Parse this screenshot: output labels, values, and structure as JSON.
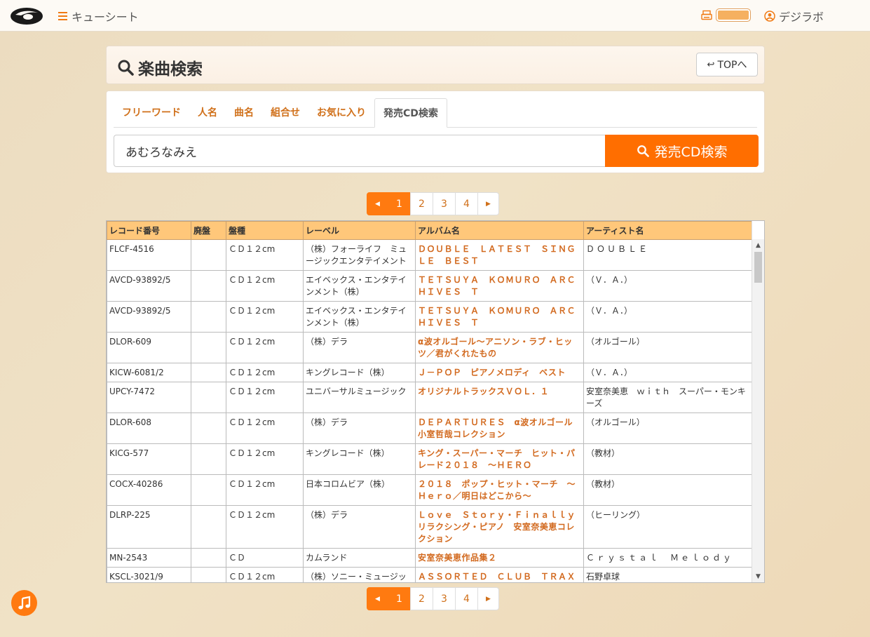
{
  "header": {
    "menu_label": "キューシート",
    "user_label": "デジラボ"
  },
  "title_panel": {
    "title": "楽曲検索",
    "top_button": "TOPへ"
  },
  "search": {
    "tabs": [
      {
        "label": "フリーワード",
        "active": false
      },
      {
        "label": "人名",
        "active": false
      },
      {
        "label": "曲名",
        "active": false
      },
      {
        "label": "組合せ",
        "active": false
      },
      {
        "label": "お気に入り",
        "active": false
      },
      {
        "label": "発売CD検索",
        "active": true
      }
    ],
    "query": "あむろなみえ",
    "button_label": "発売CD検索"
  },
  "pagination": {
    "pages": [
      "1",
      "2",
      "3",
      "4"
    ],
    "current": "1"
  },
  "table": {
    "columns": [
      "レコード番号",
      "廃盤",
      "盤種",
      "レーベル",
      "アルバム名",
      "アーティスト名"
    ],
    "rows": [
      {
        "record": "FLCF-4516",
        "discontinued": "",
        "type": "ＣＤ１２cm",
        "label": "（株）フォーライフ　ミュージックエンタテイメント",
        "album": "ＤＯＵＢＬＥ　ＬＡＴＥＳＴ　ＳＩＮＧＬＥ　ＢＥＳＴ",
        "artist": "ＤＯＵＢＬＥ"
      },
      {
        "record": "AVCD-93892/5",
        "discontinued": "",
        "type": "ＣＤ１２cm",
        "label": "エイベックス・エンタテインメント（株）",
        "album": "ＴＥＴＳＵＹＡ　ＫＯＭＵＲＯ　ＡＲＣＨＩＶＥＳ　Ｔ",
        "artist": "（Ｖ．Ａ．）"
      },
      {
        "record": "AVCD-93892/5",
        "discontinued": "",
        "type": "ＣＤ１２cm",
        "label": "エイベックス・エンタテインメント（株）",
        "album": "ＴＥＴＳＵＹＡ　ＫＯＭＵＲＯ　ＡＲＣＨＩＶＥＳ　Ｔ",
        "artist": "（Ｖ．Ａ．）"
      },
      {
        "record": "DLOR-609",
        "discontinued": "",
        "type": "ＣＤ１２cm",
        "label": "（株）デラ",
        "album": "α波オルゴール〜アニソン・ラブ・ヒッツ／君がくれたもの",
        "artist": "（オルゴール）"
      },
      {
        "record": "KICW-6081/2",
        "discontinued": "",
        "type": "ＣＤ１２cm",
        "label": "キングレコード（株）",
        "album": "Ｊ－ＰＯＰ　ピアノメロディ　ベスト",
        "artist": "（Ｖ．Ａ．）"
      },
      {
        "record": "UPCY-7472",
        "discontinued": "",
        "type": "ＣＤ１２cm",
        "label": "ユニバーサルミュージック",
        "album": "オリジナルトラックスＶＯＬ．１",
        "artist": "安室奈美恵　ｗｉｔｈ　スーパー・モンキーズ"
      },
      {
        "record": "DLOR-608",
        "discontinued": "",
        "type": "ＣＤ１２cm",
        "label": "（株）デラ",
        "album": "ＤＥＰＡＲＴＵＲＥＳ　α波オルゴール　小室哲哉コレクション",
        "artist": "（オルゴール）"
      },
      {
        "record": "KICG-577",
        "discontinued": "",
        "type": "ＣＤ１２cm",
        "label": "キングレコード（株）",
        "album": "キング・スーパー・マーチ　ヒット・パレード２０１８　〜ＨＥＲＯ",
        "artist": "（教材）"
      },
      {
        "record": "COCX-40286",
        "discontinued": "",
        "type": "ＣＤ１２cm",
        "label": "日本コロムビア（株）",
        "album": "２０１８　ポップ・ヒット・マーチ　〜Ｈｅｒｏ／明日はどこから〜",
        "artist": "（教材）"
      },
      {
        "record": "DLRP-225",
        "discontinued": "",
        "type": "ＣＤ１２cm",
        "label": "（株）デラ",
        "album": "Ｌｏｖｅ　Ｓｔｏｒｙ・Ｆｉｎａｌｌｙ　リラクシング・ピアノ　安室奈美恵コレクション",
        "artist": "（ヒーリング）"
      },
      {
        "record": "MN-2543",
        "discontinued": "",
        "type": "ＣＤ",
        "label": "カムランド",
        "album": "安室奈美恵作品集２",
        "artist": "Ｃｒｙｓｔａｌ　Ｍｅｌｏｄｙ"
      },
      {
        "record": "KSCL-3021/9",
        "discontinued": "",
        "type": "ＣＤ１２cm",
        "label": "（株）ソニー・ミュージックレーベルズ",
        "album": "ＡＳＳＯＲＴＥＤ　ＣＬＵＢ　ＴＲＡＸ",
        "artist": "石野卓球"
      }
    ]
  },
  "colors": {
    "accent": "#ff6e00",
    "link": "#d2691e",
    "table_header": "#ffc77a"
  }
}
